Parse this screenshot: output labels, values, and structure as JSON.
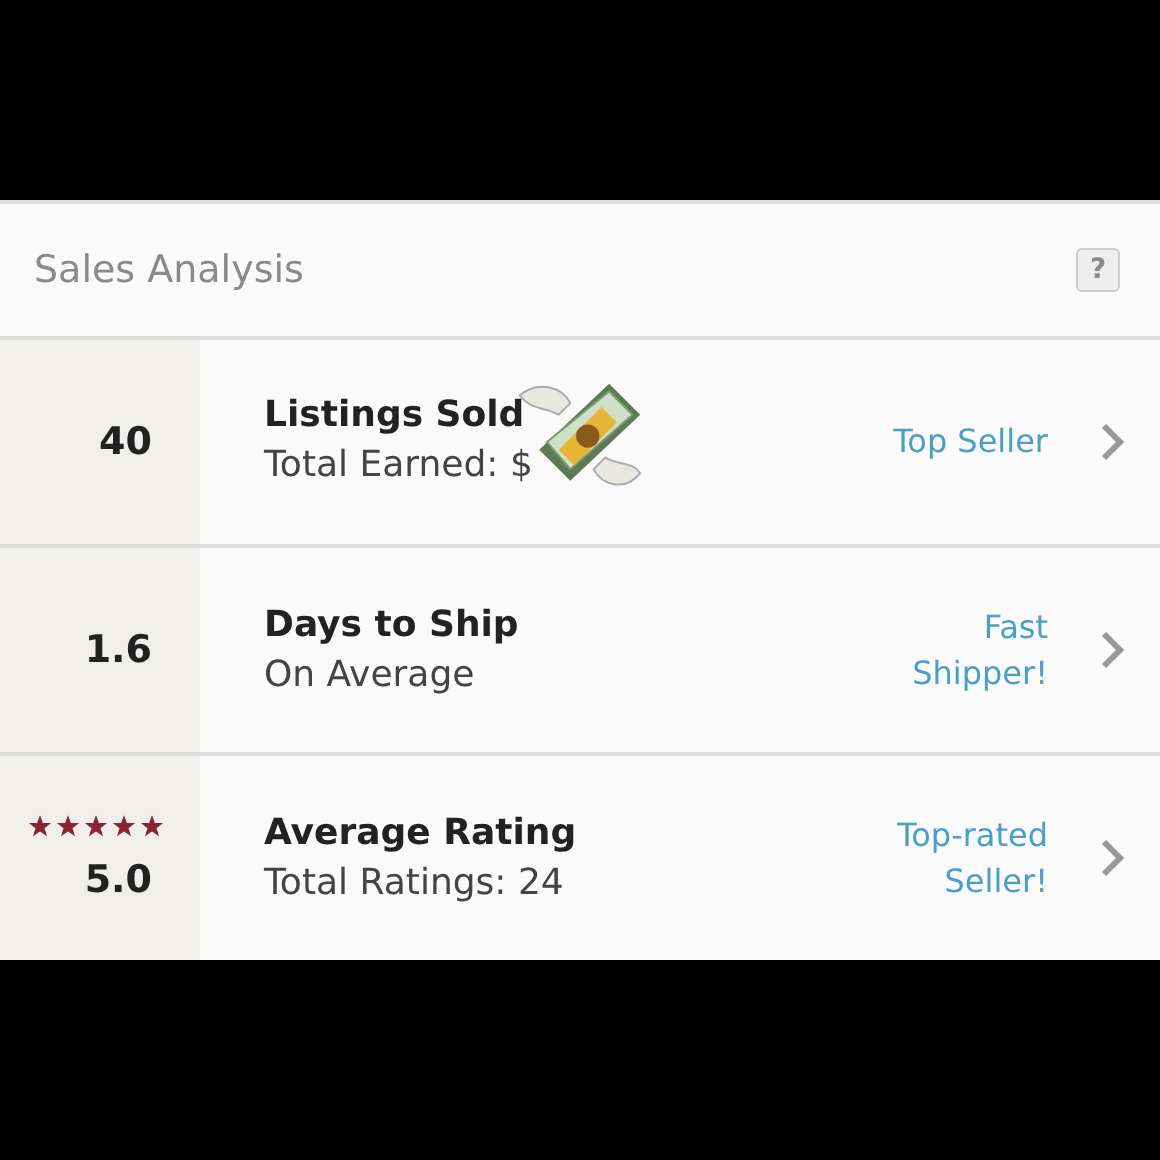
{
  "panel": {
    "title": "Sales Analysis",
    "help": "?"
  },
  "rows": [
    {
      "kind": "count",
      "value": "40",
      "title": "Listings Sold",
      "subtitle": "Total Earned: $",
      "covered": true,
      "link": "Top Seller"
    },
    {
      "kind": "count",
      "value": "1.6",
      "title": "Days to Ship",
      "subtitle": "On Average",
      "link": "Fast Shipper!"
    },
    {
      "kind": "rating",
      "stars": 5,
      "value": "5.0",
      "title": "Average Rating",
      "subtitle": "Total Ratings: 24",
      "link": "Top-rated Seller!"
    }
  ]
}
